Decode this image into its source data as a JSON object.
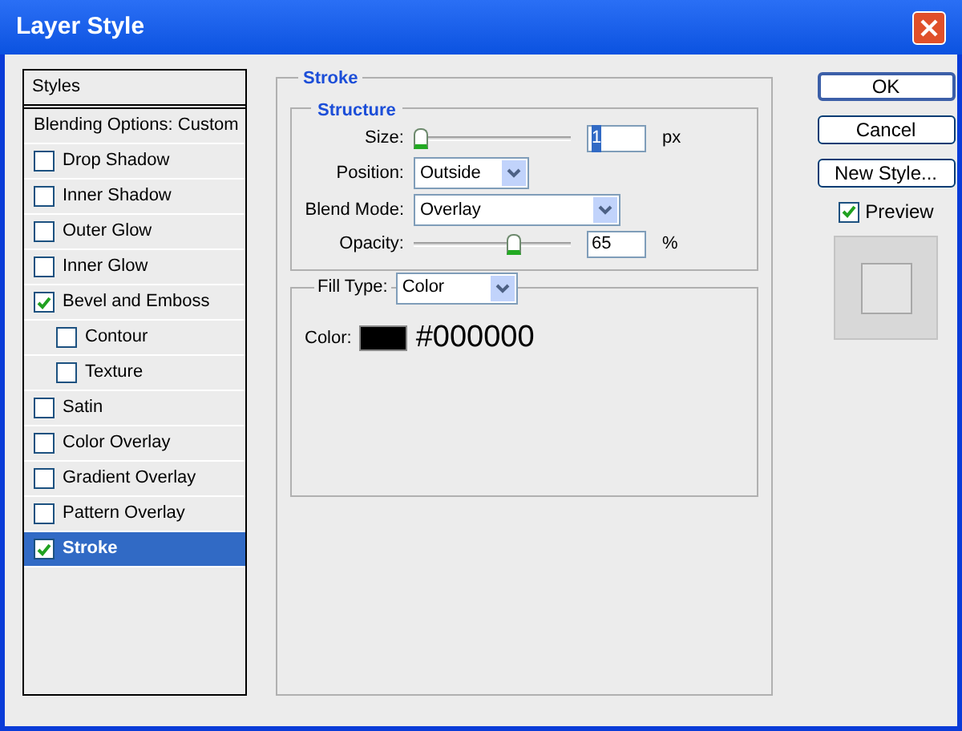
{
  "window": {
    "title": "Layer Style"
  },
  "styles": {
    "header": "Styles",
    "items": [
      {
        "label": "Blending Options: Custom",
        "kind": "plain",
        "selected": false
      },
      {
        "label": "Drop Shadow",
        "kind": "check",
        "checked": false,
        "selected": false
      },
      {
        "label": "Inner Shadow",
        "kind": "check",
        "checked": false,
        "selected": false
      },
      {
        "label": "Outer Glow",
        "kind": "check",
        "checked": false,
        "selected": false
      },
      {
        "label": "Inner Glow",
        "kind": "check",
        "checked": false,
        "selected": false
      },
      {
        "label": "Bevel and Emboss",
        "kind": "check",
        "checked": true,
        "selected": false,
        "children": [
          {
            "label": "Contour",
            "kind": "check",
            "checked": false,
            "selected": false
          },
          {
            "label": "Texture",
            "kind": "check",
            "checked": false,
            "selected": false
          }
        ]
      },
      {
        "label": "Satin",
        "kind": "check",
        "checked": false,
        "selected": false
      },
      {
        "label": "Color Overlay",
        "kind": "check",
        "checked": false,
        "selected": false
      },
      {
        "label": "Gradient Overlay",
        "kind": "check",
        "checked": false,
        "selected": false
      },
      {
        "label": "Pattern Overlay",
        "kind": "check",
        "checked": false,
        "selected": false
      },
      {
        "label": "Stroke",
        "kind": "check",
        "checked": true,
        "selected": true
      }
    ]
  },
  "stroke": {
    "title": "Stroke",
    "structure": {
      "title": "Structure",
      "size": {
        "label": "Size:",
        "level": 0,
        "value": "1",
        "text_selected": true,
        "unit": "px"
      },
      "position": {
        "label": "Position:",
        "value": "Outside"
      },
      "blend_mode": {
        "label": "Blend Mode:",
        "value": "Overlay"
      },
      "opacity": {
        "label": "Opacity:",
        "level": 0.65,
        "value": "65",
        "text_selected": false,
        "unit": "%"
      }
    },
    "fill": {
      "label": "Fill Type:",
      "value": "Color",
      "color_label": "Color:",
      "color": "#000000",
      "color_text": "#000000"
    }
  },
  "buttons": [
    {
      "label": "OK",
      "default": true
    },
    {
      "label": "Cancel",
      "default": false
    },
    {
      "label": "New Style...",
      "default": false
    }
  ],
  "preview": {
    "label": "Preview",
    "checked": true
  }
}
